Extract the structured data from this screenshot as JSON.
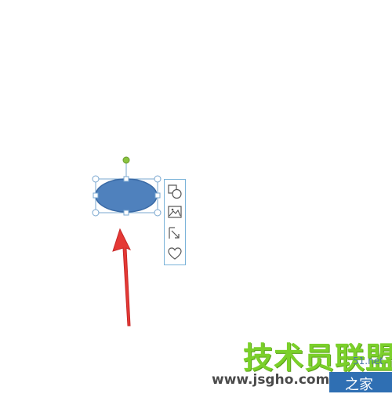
{
  "shape": {
    "fill": "#4f81bd",
    "stroke": "#3a6aa5",
    "handle_color": "#7aa7cf",
    "rotate_handle_color": "#8ac43f"
  },
  "toolbar": {
    "border_color": "#7ab3d9",
    "buttons": [
      {
        "icon": "shapes-icon"
      },
      {
        "icon": "picture-icon"
      },
      {
        "icon": "layout-arrow-icon"
      },
      {
        "icon": "heart-icon"
      }
    ]
  },
  "annotation": {
    "color": "#e53935"
  },
  "watermark": {
    "title": "技术员联盟",
    "small": "51.net",
    "url": "www.jsgho.com",
    "suffix": "之家"
  }
}
